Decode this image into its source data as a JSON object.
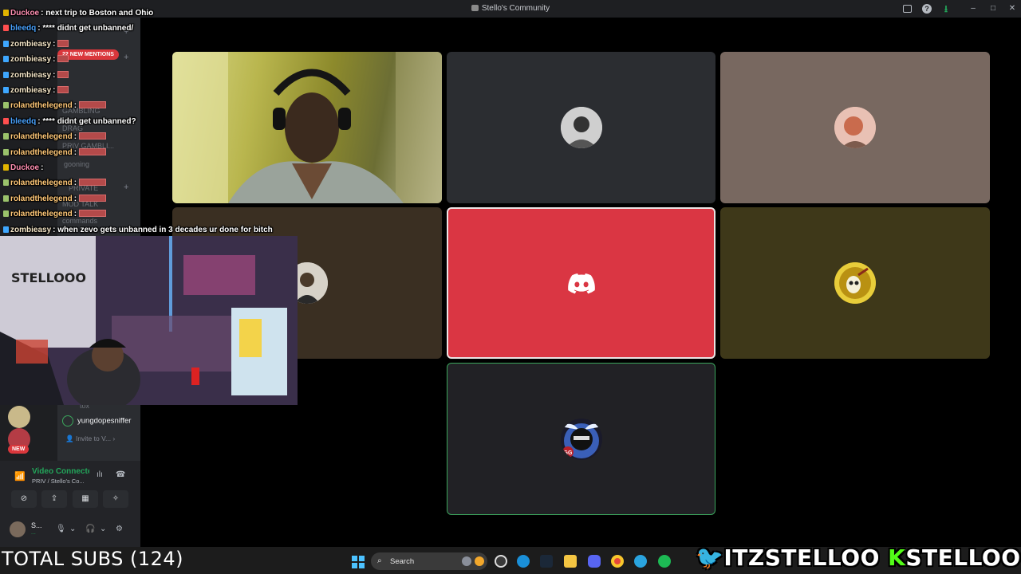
{
  "window": {
    "title": "Stello's Community"
  },
  "sidebar": {
    "mentions_badge": "22 NEW MENTIONS",
    "new_badge": "NEW",
    "channels": [
      "GAMBLING",
      "DRAG",
      "PRIV GAMBLI...",
      "gooning",
      "PRIVATE",
      "MOD TALK",
      "commands",
      "tox"
    ],
    "voice_member": "yungdopesniffer",
    "invite": "Invite to V..."
  },
  "voice_panel": {
    "title": "Video Connected",
    "subtitle": "PRIV / Stello's Co...",
    "user_name": "S...",
    "user_status": "..."
  },
  "chat": [
    {
      "user": "Duckoe",
      "color": "#ff8fb2",
      "badge": "#e0b400",
      "msg": "next trip to Boston and Ohio",
      "censor": false
    },
    {
      "user": "bleedq",
      "color": "#4aa3ff",
      "badge": "#ff4f4f",
      "msg": "**** didnt get unbanned/",
      "censor": false
    },
    {
      "user": "zombieasy",
      "color": "#f5e6c8",
      "badge": "#3ea7ff",
      "msg": "",
      "censor": "sm"
    },
    {
      "user": "zombieasy",
      "color": "#f5e6c8",
      "badge": "#3ea7ff",
      "msg": "",
      "censor": "sm"
    },
    {
      "user": "zombieasy",
      "color": "#f5e6c8",
      "badge": "#3ea7ff",
      "msg": "",
      "censor": "sm"
    },
    {
      "user": "zombieasy",
      "color": "#f5e6c8",
      "badge": "#3ea7ff",
      "msg": "",
      "censor": "sm"
    },
    {
      "user": "rolandthelegend",
      "color": "#ffc878",
      "badge": "#9ac26b",
      "msg": "",
      "censor": "lg"
    },
    {
      "user": "bleedq",
      "color": "#4aa3ff",
      "badge": "#ff4f4f",
      "msg": "**** didnt get unbanned?",
      "censor": false
    },
    {
      "user": "rolandthelegend",
      "color": "#ffc878",
      "badge": "#9ac26b",
      "msg": "",
      "censor": "lg"
    },
    {
      "user": "rolandthelegend",
      "color": "#ffc878",
      "badge": "#9ac26b",
      "msg": "",
      "censor": "lg"
    },
    {
      "user": "Duckoe",
      "color": "#ff8fb2",
      "badge": "#e0b400",
      "msg": "",
      "censor": false
    },
    {
      "user": "rolandthelegend",
      "color": "#ffc878",
      "badge": "#9ac26b",
      "msg": "",
      "censor": "lg"
    },
    {
      "user": "rolandthelegend",
      "color": "#ffc878",
      "badge": "#9ac26b",
      "msg": "",
      "censor": "lg"
    },
    {
      "user": "rolandthelegend",
      "color": "#ffc878",
      "badge": "#9ac26b",
      "msg": "",
      "censor": "lg"
    },
    {
      "user": "zombieasy",
      "color": "#f5e6c8",
      "badge": "#3ea7ff",
      "msg": "when zevo gets unbanned in 3 decades ur done for bitch",
      "censor": false
    }
  ],
  "overlay": {
    "total_subs": "TOTAL SUBS (124)",
    "twitter_handle": "ITZSTELLOO",
    "kick_handle": "STELLOOO"
  },
  "taskbar": {
    "search_label": "Search"
  },
  "colors": {
    "discord_red": "#da3643",
    "speaking_green": "#3ba55c",
    "blurple": "#5865f2"
  }
}
